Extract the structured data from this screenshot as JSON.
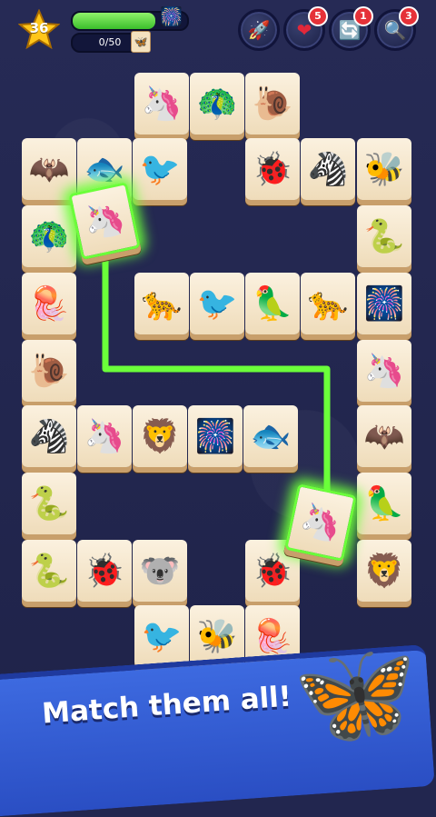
{
  "hud": {
    "level": "36",
    "progress_fraction": 0.72,
    "match_counter": "0/50",
    "boosters": [
      {
        "name": "rocket-booster",
        "glyph": "🚀",
        "badge": ""
      },
      {
        "name": "heart-booster",
        "glyph": "❤",
        "badge": "5"
      },
      {
        "name": "shuffle-booster",
        "glyph": "🔄",
        "badge": "1"
      },
      {
        "name": "hint-booster",
        "glyph": "🔍",
        "badge": "3"
      }
    ]
  },
  "board": {
    "tiles": [
      {
        "id": "t1",
        "animal": "seahorse",
        "glyph": "🦄"
      },
      {
        "id": "t2",
        "animal": "peacock",
        "glyph": "🦚"
      },
      {
        "id": "t3",
        "animal": "snail",
        "glyph": "🐌"
      }
    ]
  },
  "banner": {
    "text": "Match them all!"
  }
}
